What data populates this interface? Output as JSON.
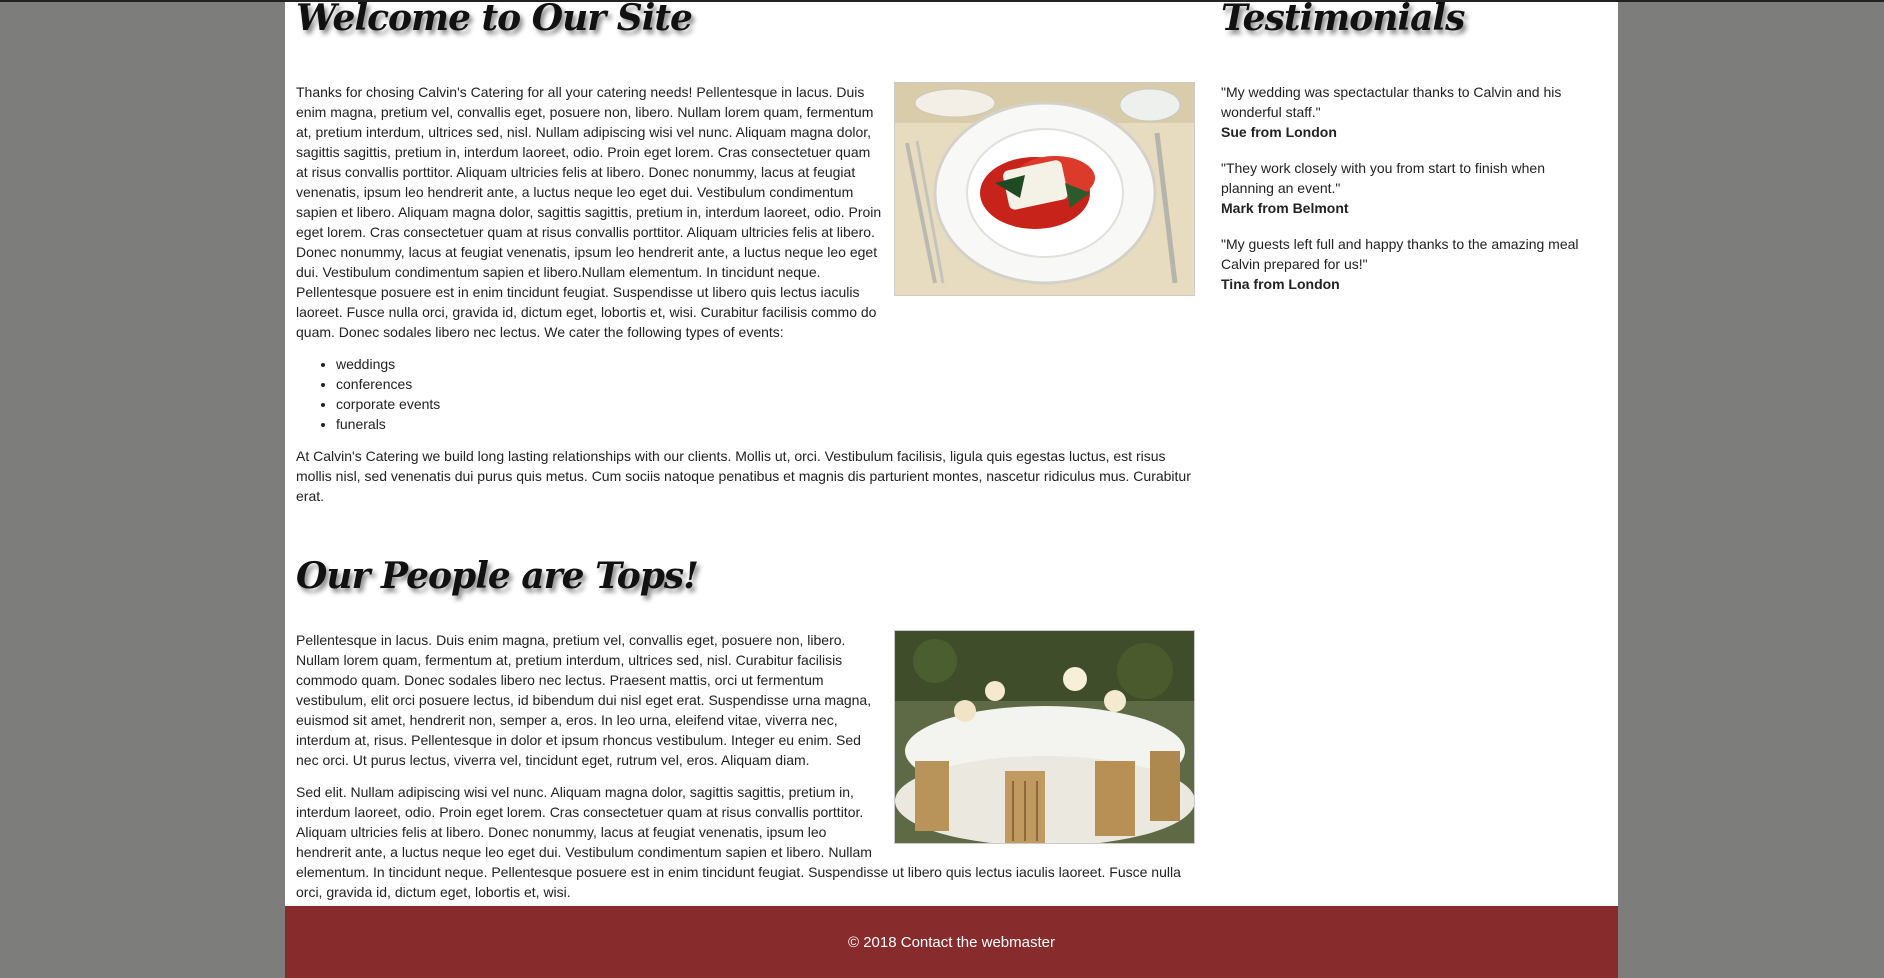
{
  "welcome": {
    "title": "Welcome to Our Site",
    "intro": "Thanks for chosing Calvin's Catering for all your catering needs! Pellentesque in lacus. Duis enim magna, pretium vel, convallis eget, posuere non, libero. Nullam lorem quam, fermentum at, pretium interdum, ultrices sed, nisl. Nullam adipiscing wisi vel nunc. Aliquam magna dolor, sagittis sagittis, pretium in, interdum laoreet, odio. Proin eget lorem. Cras consectetuer quam at risus convallis porttitor. Aliquam ultricies felis at libero. Donec nonummy, lacus at feugiat venenatis, ipsum leo hendrerit ante, a luctus neque leo eget dui. Vestibulum condimentum sapien et libero. Aliquam magna dolor, sagittis sagittis, pretium in, interdum laoreet, odio. Proin eget lorem. Cras consectetuer quam at risus convallis porttitor. Aliquam ultricies felis at libero. Donec nonummy, lacus at feugiat venenatis, ipsum leo hendrerit ante, a luctus neque leo eget dui. Vestibulum condimentum sapien et libero.Nullam elementum. In tincidunt neque. Pellentesque posuere est in enim tincidunt feugiat. Suspendisse ut libero quis lectus iaculis laoreet. Fusce nulla orci, gravida id, dictum eget, lobortis et, wisi. Curabitur facilisis commo do quam. Donec sodales libero nec lectus. We cater the following types of events:",
    "events": [
      "weddings",
      "conferences",
      "corporate events",
      "funerals"
    ],
    "closing": "At Calvin's Catering we build long lasting relationships with our clients. Mollis ut, orci. Vestibulum facilisis, ligula quis egestas luctus, est risus mollis nisl, sed venenatis dui purus quis metus. Cum sociis natoque penatibus et magnis dis parturient montes, nascetur ridiculus mus. Curabitur erat."
  },
  "people": {
    "title": "Our People are Tops!",
    "para1": "Pellentesque in lacus. Duis enim magna, pretium vel, convallis eget, posuere non, libero. Nullam lorem quam, fermentum at, pretium interdum, ultrices sed, nisl. Curabitur facilisis commodo quam. Donec sodales libero nec lectus. Praesent mattis, orci ut fermentum vestibulum, elit orci posuere lectus, id bibendum dui nisl eget erat. Suspendisse urna magna, euismod sit amet, hendrerit non, semper a, eros. In leo urna, eleifend vitae, viverra nec, interdum at, risus. Pellentesque in dolor et ipsum rhoncus vestibulum. Integer eu enim. Sed nec orci. Ut purus lectus, viverra vel, tincidunt eget, rutrum vel, eros. Aliquam diam.",
    "para2": "Sed elit. Nullam adipiscing wisi vel nunc. Aliquam magna dolor, sagittis sagittis, pretium in, interdum laoreet, odio. Proin eget lorem. Cras consectetuer quam at risus convallis porttitor. Aliquam ultricies felis at libero. Donec nonummy, lacus at feugiat venenatis, ipsum leo hendrerit ante, a luctus neque leo eget dui. Vestibulum condimentum sapien et libero. Nullam elementum. In tincidunt neque. Pellentesque posuere est in enim tincidunt feugiat. Suspendisse ut libero quis lectus iaculis laoreet. Fusce nulla orci, gravida id, dictum eget, lobortis et, wisi."
  },
  "testimonials": {
    "title": "Testimonials",
    "items": [
      {
        "quote": "\"My wedding was spectactular thanks to Calvin and his wonderful staff.\"",
        "author": "Sue from London"
      },
      {
        "quote": "\"They work closely with you from start to finish when planning an event.\"",
        "author": "Mark from Belmont"
      },
      {
        "quote": "\"My guests left full and happy thanks to the amazing meal Calvin prepared for us!\"",
        "author": "Tina from London"
      }
    ]
  },
  "footer": {
    "copyright": "© 2018",
    "link": "Contact the webmaster"
  },
  "colors": {
    "background": "#7d7d7b",
    "footer": "#882b2c"
  }
}
